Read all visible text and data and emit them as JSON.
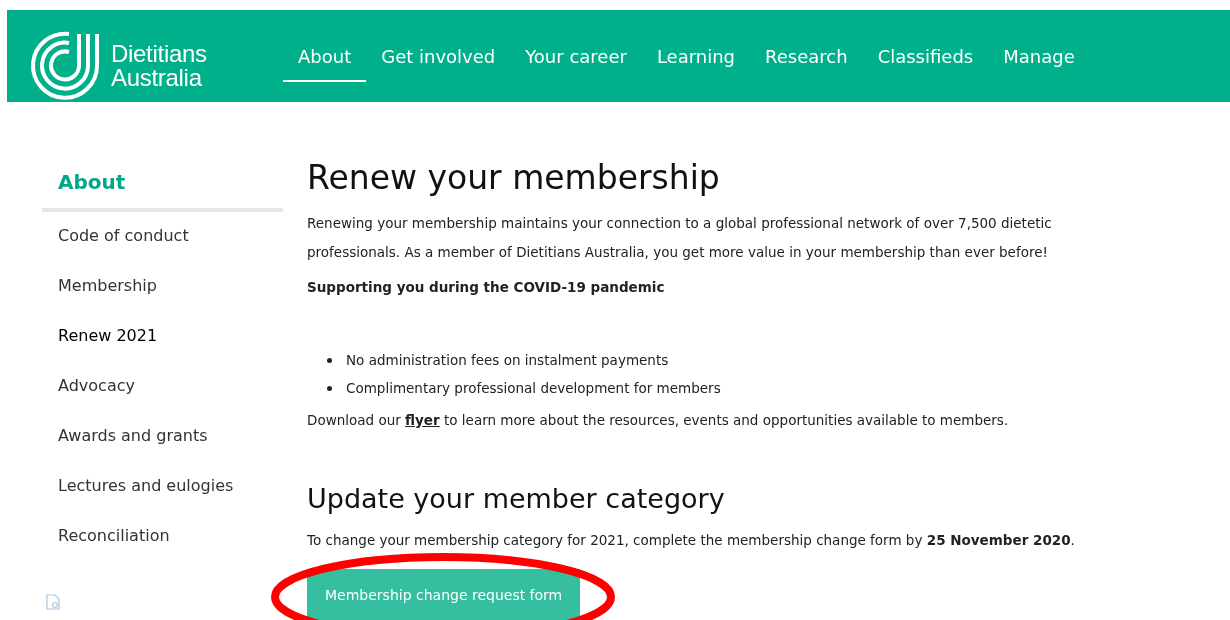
{
  "header": {
    "logo_text": [
      "Dietitians",
      "Australia"
    ],
    "nav": [
      {
        "label": "About",
        "selected": true
      },
      {
        "label": "Get involved",
        "selected": false
      },
      {
        "label": "Your career",
        "selected": false
      },
      {
        "label": "Learning",
        "selected": false
      },
      {
        "label": "Research",
        "selected": false
      },
      {
        "label": "Classifieds",
        "selected": false
      },
      {
        "label": "Manage",
        "selected": false
      }
    ]
  },
  "sidebar": {
    "title": "About",
    "items": [
      {
        "label": "Code of conduct",
        "selected": false
      },
      {
        "label": "Membership",
        "selected": false
      },
      {
        "label": "Renew 2021",
        "selected": true
      },
      {
        "label": "Advocacy",
        "selected": false
      },
      {
        "label": "Awards and grants",
        "selected": false
      },
      {
        "label": "Lectures and eulogies",
        "selected": false
      },
      {
        "label": "Reconciliation",
        "selected": false
      }
    ]
  },
  "main": {
    "title": "Renew your membership",
    "intro": "Renewing your membership maintains your connection to a global professional network of over 7,500 dietetic professionals. As a member of Dietitians Australia, you get more value in your membership than ever before!",
    "subheading": "Supporting you during the COVID-19 pandemic",
    "bullets": [
      "No administration fees on instalment payments",
      "Complimentary professional development for members"
    ],
    "download": {
      "before": "Download our ",
      "link": "flyer",
      "after": " to learn more about the resources, events and opportunities available to members."
    },
    "section_title": "Update your member category",
    "section_text": "To change your membership category for 2021, complete the membership change form by **25 November 2020**.",
    "button": "Membership change request form"
  },
  "annotation": {
    "kind": "ellipse",
    "color": "#ff0000"
  }
}
